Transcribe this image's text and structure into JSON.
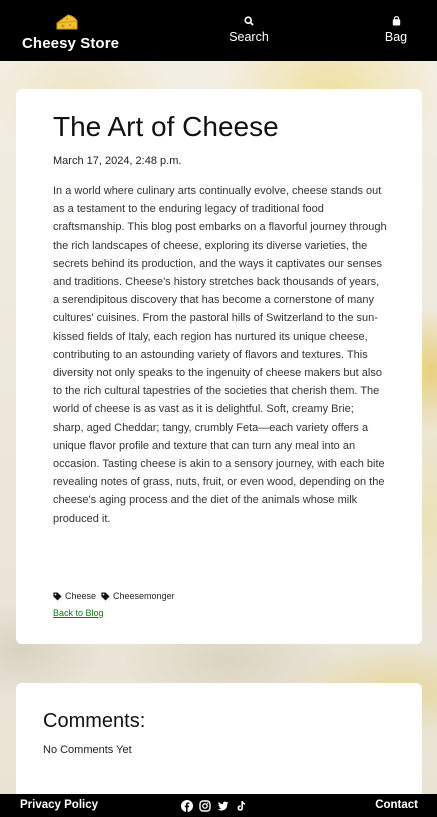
{
  "header": {
    "brand": "Cheesy Store",
    "brand_icon": "cheese-icon",
    "nav": {
      "search_label": "Search",
      "search_icon": "search-icon",
      "bag_label": "Bag",
      "bag_icon": "bag-icon"
    }
  },
  "post": {
    "title": "The Art of Cheese",
    "date": "March 17, 2024, 2:48 p.m.",
    "body": "In a world where culinary arts continually evolve, cheese stands out as a testament to the enduring legacy of traditional food craftsmanship. This blog post embarks on a flavorful journey through the rich landscapes of cheese, exploring its diverse varieties, the secrets behind its production, and the ways it captivates our senses and traditions. Cheese's history stretches back thousands of years, a serendipitous discovery that has become a cornerstone of many cultures' cuisines. From the pastoral hills of Switzerland to the sun-kissed fields of Italy, each region has nurtured its unique cheese, contributing to an astounding variety of flavors and textures. This diversity not only speaks to the ingenuity of cheese makers but also to the rich cultural tapestries of the societies that cherish them. The world of cheese is as vast as it is delightful. Soft, creamy Brie; sharp, aged Cheddar; tangy, crumbly Feta—each variety offers a unique flavor profile and texture that can turn any meal into an occasion. Tasting cheese is akin to a sensory journey, with each bite revealing notes of grass, nuts, fruit, or even wood, depending on the cheese's aging process and the diet of the animals whose milk produced it.",
    "tags": [
      "Cheese",
      "Cheesemonger"
    ],
    "back_link": "Back to Blog"
  },
  "comments": {
    "title": "Comments:",
    "empty_text": "No Comments Yet"
  },
  "footer": {
    "privacy": "Privacy Policy",
    "contact": "Contact",
    "socials": [
      "facebook-icon",
      "instagram-icon",
      "twitter-icon",
      "tiktok-icon"
    ]
  },
  "colors": {
    "header_bg": "#000000",
    "link": "#0a7d12",
    "brand_icon": "#f2c230"
  }
}
